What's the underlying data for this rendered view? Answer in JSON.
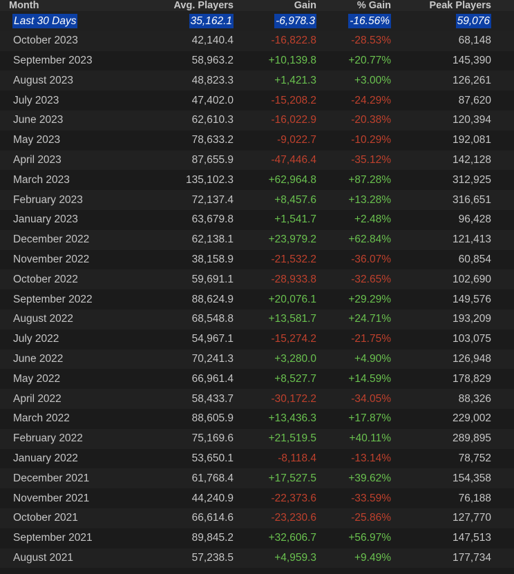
{
  "columns": {
    "month": "Month",
    "avg": "Avg. Players",
    "gain": "Gain",
    "pct": "% Gain",
    "peak": "Peak Players"
  },
  "current": {
    "month": "Last 30 Days",
    "avg": "35,162.1",
    "gain": "-6,978.3",
    "pct": "-16.56%",
    "peak": "59,076"
  },
  "rows": [
    {
      "month": "October 2023",
      "avg": "42,140.4",
      "gain": "-16,822.8",
      "pct": "-28.53%",
      "peak": "68,148",
      "trend": "neg"
    },
    {
      "month": "September 2023",
      "avg": "58,963.2",
      "gain": "+10,139.8",
      "pct": "+20.77%",
      "peak": "145,390",
      "trend": "pos"
    },
    {
      "month": "August 2023",
      "avg": "48,823.3",
      "gain": "+1,421.3",
      "pct": "+3.00%",
      "peak": "126,261",
      "trend": "pos"
    },
    {
      "month": "July 2023",
      "avg": "47,402.0",
      "gain": "-15,208.2",
      "pct": "-24.29%",
      "peak": "87,620",
      "trend": "neg"
    },
    {
      "month": "June 2023",
      "avg": "62,610.3",
      "gain": "-16,022.9",
      "pct": "-20.38%",
      "peak": "120,394",
      "trend": "neg"
    },
    {
      "month": "May 2023",
      "avg": "78,633.2",
      "gain": "-9,022.7",
      "pct": "-10.29%",
      "peak": "192,081",
      "trend": "neg"
    },
    {
      "month": "April 2023",
      "avg": "87,655.9",
      "gain": "-47,446.4",
      "pct": "-35.12%",
      "peak": "142,128",
      "trend": "neg"
    },
    {
      "month": "March 2023",
      "avg": "135,102.3",
      "gain": "+62,964.8",
      "pct": "+87.28%",
      "peak": "312,925",
      "trend": "pos"
    },
    {
      "month": "February 2023",
      "avg": "72,137.4",
      "gain": "+8,457.6",
      "pct": "+13.28%",
      "peak": "316,651",
      "trend": "pos"
    },
    {
      "month": "January 2023",
      "avg": "63,679.8",
      "gain": "+1,541.7",
      "pct": "+2.48%",
      "peak": "96,428",
      "trend": "pos"
    },
    {
      "month": "December 2022",
      "avg": "62,138.1",
      "gain": "+23,979.2",
      "pct": "+62.84%",
      "peak": "121,413",
      "trend": "pos"
    },
    {
      "month": "November 2022",
      "avg": "38,158.9",
      "gain": "-21,532.2",
      "pct": "-36.07%",
      "peak": "60,854",
      "trend": "neg"
    },
    {
      "month": "October 2022",
      "avg": "59,691.1",
      "gain": "-28,933.8",
      "pct": "-32.65%",
      "peak": "102,690",
      "trend": "neg"
    },
    {
      "month": "September 2022",
      "avg": "88,624.9",
      "gain": "+20,076.1",
      "pct": "+29.29%",
      "peak": "149,576",
      "trend": "pos"
    },
    {
      "month": "August 2022",
      "avg": "68,548.8",
      "gain": "+13,581.7",
      "pct": "+24.71%",
      "peak": "193,209",
      "trend": "pos"
    },
    {
      "month": "July 2022",
      "avg": "54,967.1",
      "gain": "-15,274.2",
      "pct": "-21.75%",
      "peak": "103,075",
      "trend": "neg"
    },
    {
      "month": "June 2022",
      "avg": "70,241.3",
      "gain": "+3,280.0",
      "pct": "+4.90%",
      "peak": "126,948",
      "trend": "pos"
    },
    {
      "month": "May 2022",
      "avg": "66,961.4",
      "gain": "+8,527.7",
      "pct": "+14.59%",
      "peak": "178,829",
      "trend": "pos"
    },
    {
      "month": "April 2022",
      "avg": "58,433.7",
      "gain": "-30,172.2",
      "pct": "-34.05%",
      "peak": "88,326",
      "trend": "neg"
    },
    {
      "month": "March 2022",
      "avg": "88,605.9",
      "gain": "+13,436.3",
      "pct": "+17.87%",
      "peak": "229,002",
      "trend": "pos"
    },
    {
      "month": "February 2022",
      "avg": "75,169.6",
      "gain": "+21,519.5",
      "pct": "+40.11%",
      "peak": "289,895",
      "trend": "pos"
    },
    {
      "month": "January 2022",
      "avg": "53,650.1",
      "gain": "-8,118.4",
      "pct": "-13.14%",
      "peak": "78,752",
      "trend": "neg"
    },
    {
      "month": "December 2021",
      "avg": "61,768.4",
      "gain": "+17,527.5",
      "pct": "+39.62%",
      "peak": "154,358",
      "trend": "pos"
    },
    {
      "month": "November 2021",
      "avg": "44,240.9",
      "gain": "-22,373.6",
      "pct": "-33.59%",
      "peak": "76,188",
      "trend": "neg"
    },
    {
      "month": "October 2021",
      "avg": "66,614.6",
      "gain": "-23,230.6",
      "pct": "-25.86%",
      "peak": "127,770",
      "trend": "neg"
    },
    {
      "month": "September 2021",
      "avg": "89,845.2",
      "gain": "+32,606.7",
      "pct": "+56.97%",
      "peak": "147,513",
      "trend": "pos"
    },
    {
      "month": "August 2021",
      "avg": "57,238.5",
      "gain": "+4,959.3",
      "pct": "+9.49%",
      "peak": "177,734",
      "trend": "pos"
    }
  ],
  "colors": {
    "background": "#1b1b1b",
    "row_alt": "#212121",
    "positive": "#6ac24f",
    "negative": "#c0412d",
    "highlight": "#0c3fa4"
  }
}
